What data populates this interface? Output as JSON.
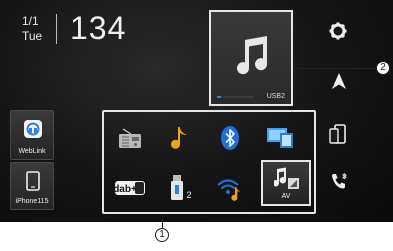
{
  "status": {
    "date_line1": "1/1",
    "date_line2": "Tue",
    "time": "134"
  },
  "now_playing": {
    "source_label": "USB2",
    "progress": 0.1,
    "icon": "music-note-icon"
  },
  "side_buttons": [
    {
      "label": "WebLink",
      "icon": "weblink-icon"
    },
    {
      "label": "iPhone115",
      "icon": "phone-icon"
    }
  ],
  "sources": [
    {
      "name": "radio",
      "icon": "radio-icon"
    },
    {
      "name": "music",
      "icon": "music-note-icon"
    },
    {
      "name": "bluetooth",
      "icon": "bluetooth-icon"
    },
    {
      "name": "mirroring",
      "icon": "screen-mirror-icon"
    },
    {
      "name": "dab",
      "icon": "dab-icon",
      "label": "dab+"
    },
    {
      "name": "usb",
      "icon": "usb-icon",
      "label": "2"
    },
    {
      "name": "wireless-audio",
      "icon": "wifi-music-icon"
    }
  ],
  "av_button": {
    "label": "AV"
  },
  "right_icons": [
    "gear-icon",
    "navigation-arrow-icon",
    "phone-mirror-icon",
    "bluetooth-phone-icon"
  ],
  "callouts": {
    "one": "1",
    "two": "2"
  },
  "colors": {
    "accent_blue": "#2f7fe0",
    "music_orange": "#f0a020"
  }
}
